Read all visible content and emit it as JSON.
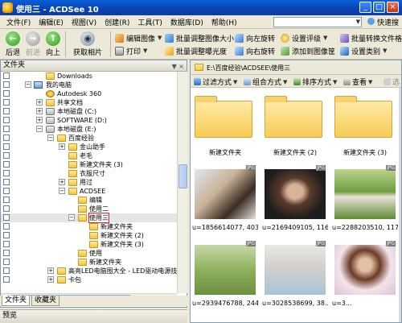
{
  "window": {
    "title": "使用三 - ACDSee 10"
  },
  "menu": {
    "items": [
      "文件(F)",
      "编辑(E)",
      "视图(V)",
      "创建(R)",
      "工具(T)",
      "数据库(D)",
      "帮助(H)"
    ],
    "quick_search_label": "快速搜索"
  },
  "toolbar": {
    "back": "后退",
    "forward": "前进",
    "up": "向上",
    "acquire": "获取相片",
    "edit_image": "编辑图像",
    "print": "打印",
    "batch_resize": "批量调整图像大小",
    "batch_exposure": "批量调整曝光度",
    "rotate_left": "向左旋转",
    "rotate_right": "向右旋转",
    "set_rating": "设置评级",
    "add_to_basket": "添加到图像筐",
    "batch_convert": "批量转换文件格式",
    "set_category": "设置类别"
  },
  "folders_panel": {
    "title": "文件夹",
    "tree": [
      {
        "label": "Downloads",
        "icon": "folder-icon"
      },
      {
        "label": "我的电脑",
        "icon": "computer-icon"
      },
      {
        "label": "Autodesk 360",
        "icon": "app-icon"
      },
      {
        "label": "共享文档",
        "icon": "folder-icon"
      },
      {
        "label": "本地磁盘 (C:)",
        "icon": "drive-icon"
      },
      {
        "label": "SOFTWARE (D:)",
        "icon": "drive-icon"
      },
      {
        "label": "本地磁盘 (E:)",
        "icon": "drive-icon"
      },
      {
        "label": "百度经验",
        "icon": "folder-icon"
      },
      {
        "label": "金山助手",
        "icon": "folder-icon"
      },
      {
        "label": "老毛",
        "icon": "folder-icon"
      },
      {
        "label": "新建文件夹 (3)",
        "icon": "folder-icon"
      },
      {
        "label": "衣服尺寸",
        "icon": "folder-icon"
      },
      {
        "label": "用过",
        "icon": "folder-icon"
      },
      {
        "label": "ACDSEE",
        "icon": "folder-icon"
      },
      {
        "label": "编辑",
        "icon": "folder-icon"
      },
      {
        "label": "使用二",
        "icon": "folder-icon"
      },
      {
        "label": "使用三",
        "icon": "folder-icon"
      },
      {
        "label": "新建文件夹",
        "icon": "folder-icon"
      },
      {
        "label": "新建文件夹 (2)",
        "icon": "folder-icon"
      },
      {
        "label": "新建文件夹 (3)",
        "icon": "folder-icon"
      },
      {
        "label": "使用",
        "icon": "folder-icon"
      },
      {
        "label": "新建文件夹",
        "icon": "folder-icon"
      },
      {
        "label": "高亮LED电脑图大全 - LED驱动电源技",
        "icon": "folder-icon"
      },
      {
        "label": "卡包",
        "icon": "folder-icon"
      }
    ],
    "tabs": [
      "文件夹",
      "收藏夹"
    ]
  },
  "preview_panel": {
    "title": "预览"
  },
  "browser": {
    "path": "E:\\百度经验\\ACDSEE\\使用三",
    "filters": {
      "filter": "过滤方式",
      "group": "组合方式",
      "sort": "排序方式",
      "view": "查看",
      "select": "选"
    },
    "items": [
      {
        "caption": "新建文件夹",
        "kind": "folder"
      },
      {
        "caption": "新建文件夹 (2)",
        "kind": "folder"
      },
      {
        "caption": "新建文件夹 (3)",
        "kind": "folder"
      },
      {
        "caption": "u=1856614077, 403...",
        "kind": "photo",
        "badge": "JPG"
      },
      {
        "caption": "u=2169409105, 116...",
        "kind": "photo",
        "badge": "JPG"
      },
      {
        "caption": "u=2288203510, 117...",
        "kind": "photo",
        "badge": "JPG"
      },
      {
        "caption": "u=2939476788, 244...",
        "kind": "photo",
        "badge": "JPG"
      },
      {
        "caption": "u=3028538699, 38...",
        "kind": "photo",
        "badge": "JPG"
      },
      {
        "caption": "u=3...",
        "kind": "photo",
        "badge": "JPG"
      }
    ]
  }
}
